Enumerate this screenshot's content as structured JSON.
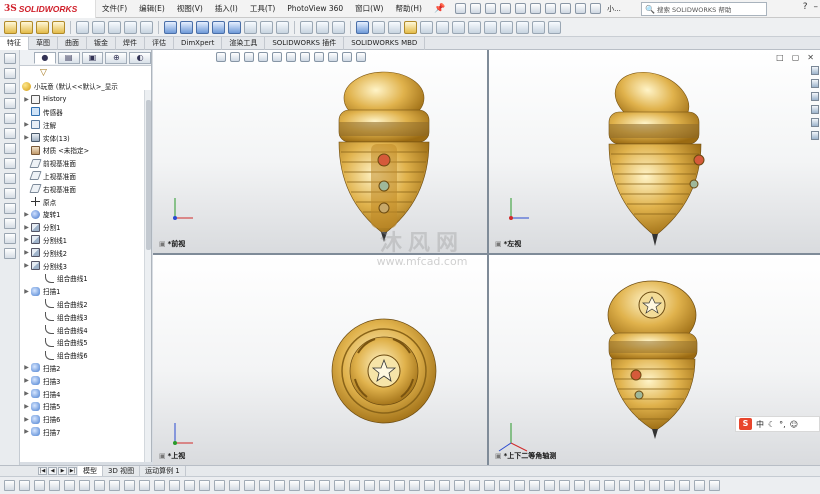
{
  "app": {
    "brand_ds": "3S",
    "brand_name": "SOLIDWORKS"
  },
  "menu": [
    "文件(F)",
    "编辑(E)",
    "视图(V)",
    "插入(I)",
    "工具(T)",
    "PhotoView 360",
    "窗口(W)",
    "帮助(H)"
  ],
  "file_name_short": "小...",
  "search": {
    "placeholder": "搜索 SOLIDWORKS 帮助"
  },
  "command_tabs": [
    "特征",
    "草图",
    "曲面",
    "钣金",
    "焊件",
    "评估",
    "DimXpert",
    "渲染工具",
    "SOLIDWORKS 插件",
    "SOLIDWORKS MBD"
  ],
  "feature_tree": {
    "root": "小玩意 (默认<<默认>_显示",
    "items": [
      {
        "label": "History",
        "icon": "hist"
      },
      {
        "label": "传感器",
        "icon": "sens"
      },
      {
        "label": "注解",
        "icon": "ann"
      },
      {
        "label": "实体(13)",
        "icon": "solid"
      },
      {
        "label": "材质 <未指定>",
        "icon": "mat"
      },
      {
        "label": "前视基准面",
        "icon": "plane"
      },
      {
        "label": "上视基准面",
        "icon": "plane"
      },
      {
        "label": "右视基准面",
        "icon": "plane"
      },
      {
        "label": "原点",
        "icon": "orig"
      },
      {
        "label": "旋转1",
        "icon": "rev"
      },
      {
        "label": "分割1",
        "icon": "split"
      },
      {
        "label": "分割线1",
        "icon": "split"
      },
      {
        "label": "分割线2",
        "icon": "split"
      },
      {
        "label": "分割线3",
        "icon": "split"
      },
      {
        "label": "组合曲线1",
        "icon": "curve"
      },
      {
        "label": "扫描1",
        "icon": "sweep"
      },
      {
        "label": "组合曲线2",
        "icon": "curve"
      },
      {
        "label": "组合曲线3",
        "icon": "curve"
      },
      {
        "label": "组合曲线4",
        "icon": "curve"
      },
      {
        "label": "组合曲线5",
        "icon": "curve"
      },
      {
        "label": "组合曲线6",
        "icon": "curve"
      },
      {
        "label": "扫描2",
        "icon": "sweep"
      },
      {
        "label": "扫描3",
        "icon": "sweep"
      },
      {
        "label": "扫描4",
        "icon": "sweep"
      },
      {
        "label": "扫描5",
        "icon": "sweep"
      },
      {
        "label": "扫描6",
        "icon": "sweep"
      },
      {
        "label": "扫描7",
        "icon": "sweep"
      }
    ]
  },
  "viewports": {
    "front": "*前视",
    "left": "*左视",
    "top": "*上视",
    "iso": "*上下二等角轴测"
  },
  "watermark": {
    "line1": "沐风网",
    "line2": "www.mfcad.com"
  },
  "ime": {
    "badge": "S",
    "lang": "中"
  },
  "bottom_tabs": [
    "模型",
    "3D 视图",
    "运动算例 1"
  ],
  "colors": {
    "brand": "#d0202b",
    "gold": "#d8a63a",
    "accent_blue": "#2a6fc0"
  }
}
